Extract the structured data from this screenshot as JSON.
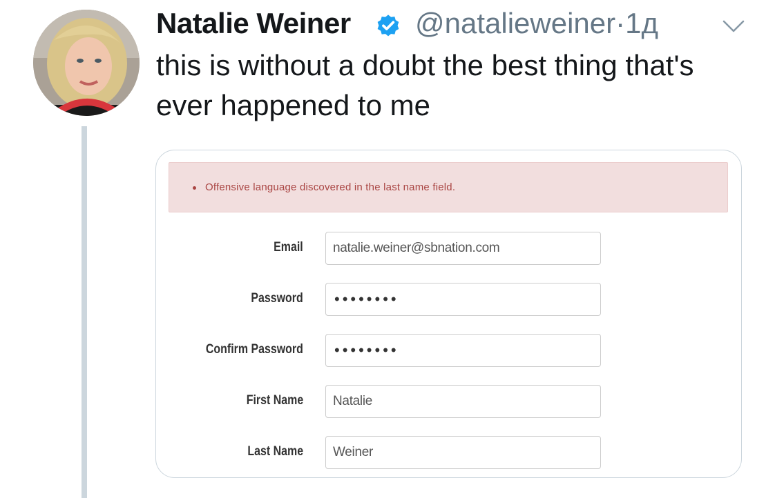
{
  "tweet": {
    "author_name": "Natalie Weiner",
    "author_handle": "@natalieweiner",
    "separator": "·",
    "time_ago": "1д",
    "text": "this is without a doubt the best thing that's ever happened to me",
    "verified_icon": "verified-badge-icon",
    "menu_icon": "chevron-down-icon",
    "avatar": "author-avatar-photo"
  },
  "signup_form": {
    "alert": {
      "message": "Offensive language discovered in the last name field."
    },
    "fields": [
      {
        "label": "Email",
        "value": "natalie.weiner@sbnation.com",
        "type": "text"
      },
      {
        "label": "Password",
        "value": "••••••••",
        "type": "password"
      },
      {
        "label": "Confirm Password",
        "value": "••••••••",
        "type": "password"
      },
      {
        "label": "First Name",
        "value": "Natalie",
        "type": "text"
      },
      {
        "label": "Last Name",
        "value": "Weiner",
        "type": "text"
      }
    ]
  },
  "colors": {
    "text_primary": "#14171a",
    "text_secondary": "#657786",
    "verified_blue": "#1da1f2",
    "thread_line": "#ccd6dd",
    "alert_background": "#f2dede",
    "alert_text": "#a94442"
  }
}
